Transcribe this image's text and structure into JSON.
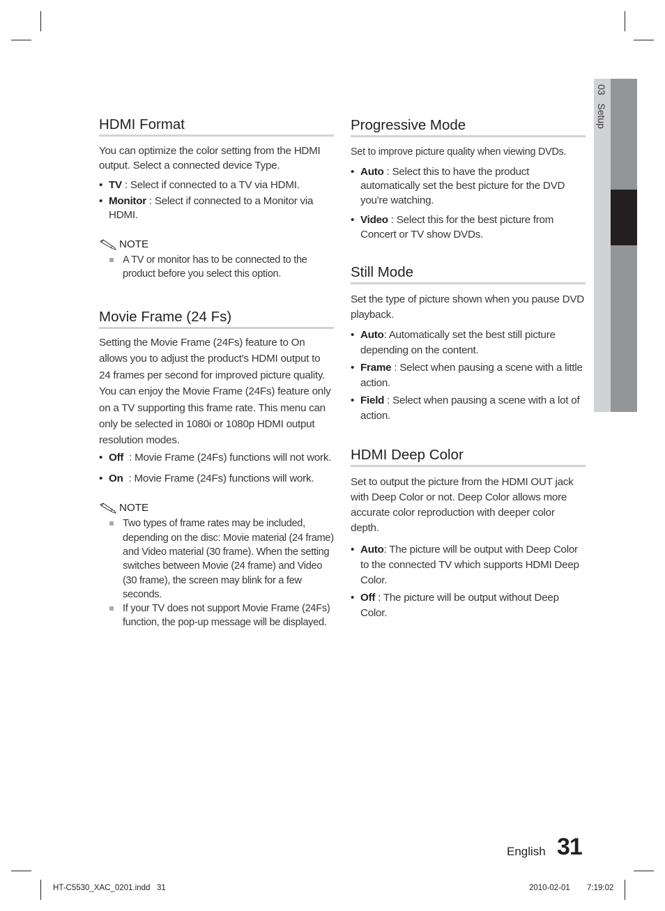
{
  "side_tab": {
    "chapter": "03",
    "label": "Setup"
  },
  "left": {
    "hdmi_format": {
      "title": "HDMI Format",
      "intro": "You can optimize the color setting from the HDMI output. Select a connected device Type.",
      "items": [
        {
          "term": "TV",
          "text": " : Select if connected to a TV via HDMI."
        },
        {
          "term": "Monitor",
          "text": " : Select if connected to a Monitor via HDMI."
        }
      ],
      "note_label": "NOTE",
      "notes": [
        "A TV or monitor has to be connected to the product before you select this option."
      ]
    },
    "movie_frame": {
      "title": "Movie Frame (24 Fs)",
      "intro": "Setting the Movie Frame (24Fs) feature to On allows you to adjust the product's HDMI output to 24 frames per second for improved picture quality. You can enjoy the Movie Frame (24Fs) feature only on a TV supporting this frame rate. This menu can only be selected in 1080i or 1080p HDMI output resolution modes.",
      "items": [
        {
          "term": "Off",
          "text": "  : Movie Frame (24Fs) functions will not work."
        },
        {
          "term": "On",
          "text": "  : Movie Frame (24Fs) functions will work."
        }
      ],
      "note_label": "NOTE",
      "notes": [
        "Two types of frame rates may be included, depending on the disc: Movie material (24 frame) and Video material (30 frame). When the setting switches between Movie (24 frame) and Video (30 frame), the screen may blink for a few seconds.",
        "If your TV does not support Movie Frame (24Fs) function, the pop-up message will be displayed."
      ]
    }
  },
  "right": {
    "progressive_mode": {
      "title": "Progressive Mode",
      "intro": "Set to improve picture quality when viewing DVDs.",
      "items": [
        {
          "term": "Auto",
          "text": " : Select this to have the product automatically set the best picture for the DVD you're watching."
        },
        {
          "term": "Video",
          "text": " : Select this for the best picture from Concert or TV show DVDs."
        }
      ]
    },
    "still_mode": {
      "title": "Still Mode",
      "intro": "Set the type of picture shown when you pause DVD playback.",
      "items": [
        {
          "term": "Auto",
          "text": ": Automatically set the best still picture depending on the content."
        },
        {
          "term": "Frame",
          "text": " : Select when pausing a scene with a little action."
        },
        {
          "term": "Field",
          "text": " : Select when pausing a scene with a lot of action."
        }
      ]
    },
    "hdmi_deep_color": {
      "title": "HDMI Deep Color",
      "intro": "Set to output the picture from the HDMI OUT jack with Deep Color or not. Deep Color allows more accurate color reproduction with deeper color depth.",
      "items": [
        {
          "term": "Auto",
          "text": ": The picture will be output with Deep Color to the connected TV which supports HDMI Deep Color."
        },
        {
          "term": "Off",
          "text": " : The picture will be output without Deep Color."
        }
      ]
    }
  },
  "footer": {
    "language": "English",
    "page_number": "31",
    "slug_file": "HT-C5530_XAC_0201.indd   31",
    "slug_date": "2010-02-01",
    "slug_time": "7:19:02"
  },
  "colors": {
    "text": "#231f20",
    "rule": "#d1d2d4",
    "tab_mid": "#939598",
    "tab_active": "#231f20"
  }
}
